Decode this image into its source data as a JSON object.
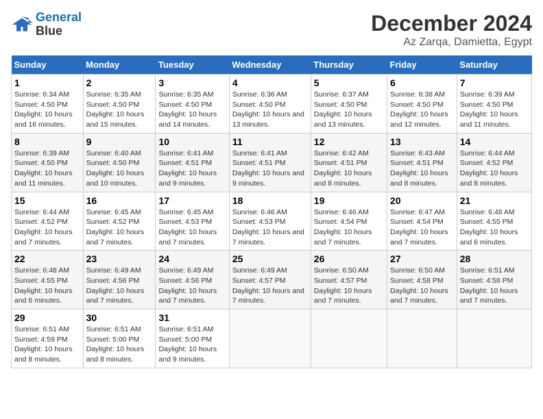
{
  "header": {
    "logo_line1": "General",
    "logo_line2": "Blue",
    "title": "December 2024",
    "subtitle": "Az Zarqa, Damietta, Egypt"
  },
  "days_of_week": [
    "Sunday",
    "Monday",
    "Tuesday",
    "Wednesday",
    "Thursday",
    "Friday",
    "Saturday"
  ],
  "weeks": [
    [
      {
        "day": "1",
        "sunrise": "6:34 AM",
        "sunset": "4:50 PM",
        "daylight": "10 hours and 16 minutes."
      },
      {
        "day": "2",
        "sunrise": "6:35 AM",
        "sunset": "4:50 PM",
        "daylight": "10 hours and 15 minutes."
      },
      {
        "day": "3",
        "sunrise": "6:35 AM",
        "sunset": "4:50 PM",
        "daylight": "10 hours and 14 minutes."
      },
      {
        "day": "4",
        "sunrise": "6:36 AM",
        "sunset": "4:50 PM",
        "daylight": "10 hours and 13 minutes."
      },
      {
        "day": "5",
        "sunrise": "6:37 AM",
        "sunset": "4:50 PM",
        "daylight": "10 hours and 13 minutes."
      },
      {
        "day": "6",
        "sunrise": "6:38 AM",
        "sunset": "4:50 PM",
        "daylight": "10 hours and 12 minutes."
      },
      {
        "day": "7",
        "sunrise": "6:39 AM",
        "sunset": "4:50 PM",
        "daylight": "10 hours and 11 minutes."
      }
    ],
    [
      {
        "day": "8",
        "sunrise": "6:39 AM",
        "sunset": "4:50 PM",
        "daylight": "10 hours and 11 minutes."
      },
      {
        "day": "9",
        "sunrise": "6:40 AM",
        "sunset": "4:50 PM",
        "daylight": "10 hours and 10 minutes."
      },
      {
        "day": "10",
        "sunrise": "6:41 AM",
        "sunset": "4:51 PM",
        "daylight": "10 hours and 9 minutes."
      },
      {
        "day": "11",
        "sunrise": "6:41 AM",
        "sunset": "4:51 PM",
        "daylight": "10 hours and 9 minutes."
      },
      {
        "day": "12",
        "sunrise": "6:42 AM",
        "sunset": "4:51 PM",
        "daylight": "10 hours and 8 minutes."
      },
      {
        "day": "13",
        "sunrise": "6:43 AM",
        "sunset": "4:51 PM",
        "daylight": "10 hours and 8 minutes."
      },
      {
        "day": "14",
        "sunrise": "6:44 AM",
        "sunset": "4:52 PM",
        "daylight": "10 hours and 8 minutes."
      }
    ],
    [
      {
        "day": "15",
        "sunrise": "6:44 AM",
        "sunset": "4:52 PM",
        "daylight": "10 hours and 7 minutes."
      },
      {
        "day": "16",
        "sunrise": "6:45 AM",
        "sunset": "4:52 PM",
        "daylight": "10 hours and 7 minutes."
      },
      {
        "day": "17",
        "sunrise": "6:45 AM",
        "sunset": "4:53 PM",
        "daylight": "10 hours and 7 minutes."
      },
      {
        "day": "18",
        "sunrise": "6:46 AM",
        "sunset": "4:53 PM",
        "daylight": "10 hours and 7 minutes."
      },
      {
        "day": "19",
        "sunrise": "6:46 AM",
        "sunset": "4:54 PM",
        "daylight": "10 hours and 7 minutes."
      },
      {
        "day": "20",
        "sunrise": "6:47 AM",
        "sunset": "4:54 PM",
        "daylight": "10 hours and 7 minutes."
      },
      {
        "day": "21",
        "sunrise": "6:48 AM",
        "sunset": "4:55 PM",
        "daylight": "10 hours and 6 minutes."
      }
    ],
    [
      {
        "day": "22",
        "sunrise": "6:48 AM",
        "sunset": "4:55 PM",
        "daylight": "10 hours and 6 minutes."
      },
      {
        "day": "23",
        "sunrise": "6:49 AM",
        "sunset": "4:56 PM",
        "daylight": "10 hours and 7 minutes."
      },
      {
        "day": "24",
        "sunrise": "6:49 AM",
        "sunset": "4:56 PM",
        "daylight": "10 hours and 7 minutes."
      },
      {
        "day": "25",
        "sunrise": "6:49 AM",
        "sunset": "4:57 PM",
        "daylight": "10 hours and 7 minutes."
      },
      {
        "day": "26",
        "sunrise": "6:50 AM",
        "sunset": "4:57 PM",
        "daylight": "10 hours and 7 minutes."
      },
      {
        "day": "27",
        "sunrise": "6:50 AM",
        "sunset": "4:58 PM",
        "daylight": "10 hours and 7 minutes."
      },
      {
        "day": "28",
        "sunrise": "6:51 AM",
        "sunset": "4:58 PM",
        "daylight": "10 hours and 7 minutes."
      }
    ],
    [
      {
        "day": "29",
        "sunrise": "6:51 AM",
        "sunset": "4:59 PM",
        "daylight": "10 hours and 8 minutes."
      },
      {
        "day": "30",
        "sunrise": "6:51 AM",
        "sunset": "5:00 PM",
        "daylight": "10 hours and 8 minutes."
      },
      {
        "day": "31",
        "sunrise": "6:51 AM",
        "sunset": "5:00 PM",
        "daylight": "10 hours and 9 minutes."
      },
      null,
      null,
      null,
      null
    ]
  ]
}
